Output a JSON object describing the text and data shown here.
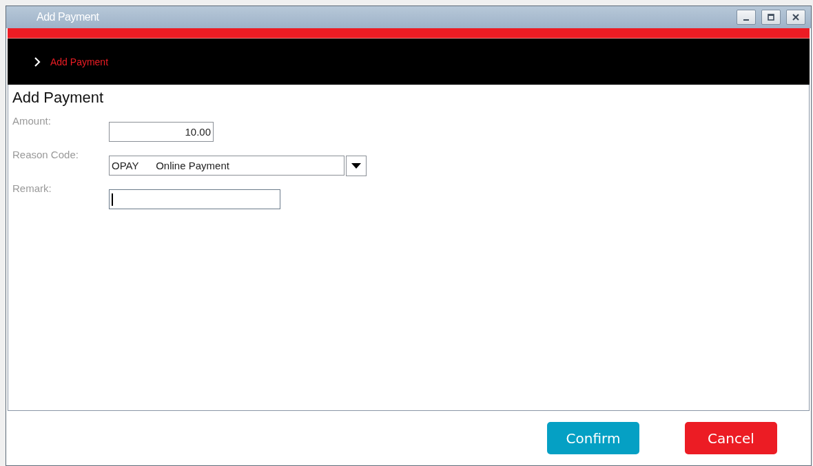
{
  "window": {
    "title": "Add Payment"
  },
  "breadcrumb": {
    "label": "Add Payment"
  },
  "form": {
    "heading": "Add Payment",
    "fields": [
      {
        "label": "Amount:",
        "kind": "number",
        "value": "10.00",
        "focused": false
      },
      {
        "label": "Reason Code:",
        "kind": "select",
        "value": "OPAY      Online Payment",
        "focused": false
      },
      {
        "label": "Remark:",
        "kind": "text",
        "focused": true
      }
    ]
  },
  "buttons": [
    {
      "label": "Confirm",
      "kind": "primary"
    },
    {
      "label": "Cancel",
      "kind": "danger"
    }
  ]
}
